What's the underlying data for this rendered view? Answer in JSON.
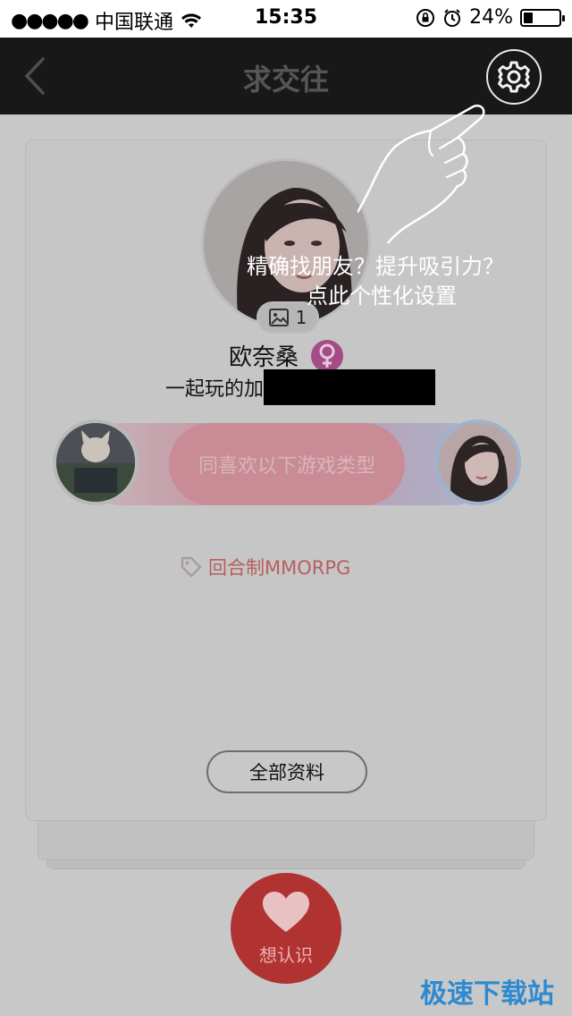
{
  "status_bar": {
    "signal": "●●●●●",
    "carrier": "中国联通",
    "time": "15:35",
    "battery_percent_label": "24%",
    "battery_level": 0.24
  },
  "nav": {
    "title": "求交往",
    "back_icon": "chevron-left-icon",
    "settings_icon": "gear-icon"
  },
  "profile": {
    "photo_count": "1",
    "name": "欧奈桑",
    "gender_icon": "female-icon",
    "gender_color": "#a34c85",
    "bio_prefix": "一起玩的加"
  },
  "match": {
    "pill_text": "同喜欢以下游戏类型"
  },
  "tags": [
    {
      "label": "回合制MMORPG",
      "icon": "tag-icon"
    }
  ],
  "buttons": {
    "all_info": "全部资料",
    "like_label": "想认识"
  },
  "tutorial": {
    "line1": "精确找朋友？提升吸引力？",
    "line2": "点此个性化设置"
  },
  "watermark": "极速下载站",
  "colors": {
    "navbar": "#181818",
    "like_button": "#b13331",
    "tag_text": "#b85e5e",
    "watermark": "#2e8ad0"
  }
}
